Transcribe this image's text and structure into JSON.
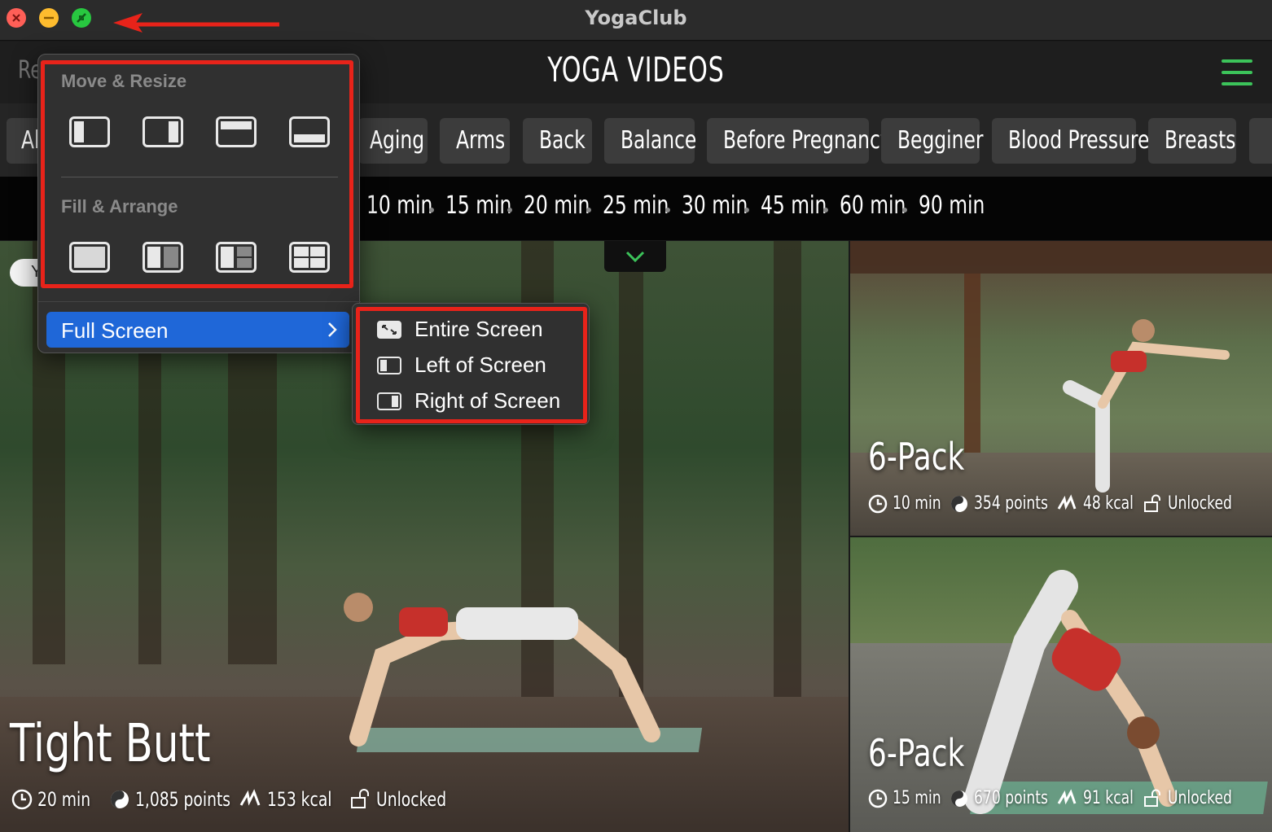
{
  "window": {
    "title": "YogaClub"
  },
  "header": {
    "title": "YOGA VIDEOS",
    "left_partial": "Re"
  },
  "categories": [
    "Ab",
    "Aging",
    "Arms",
    "Back",
    "Balance",
    "Before Pregnancy",
    "Begginer",
    "Blood Pressure",
    "Breasts"
  ],
  "durations": [
    "10 min",
    "15 min",
    "20 min",
    "25 min",
    "30 min",
    "45 min",
    "60 min",
    "90 min"
  ],
  "toggle_partial": "Y",
  "zoom_menu": {
    "move_resize_label": "Move & Resize",
    "fill_arrange_label": "Fill & Arrange",
    "full_screen_label": "Full Screen"
  },
  "full_screen_submenu": {
    "entire": "Entire Screen",
    "left": "Left of Screen",
    "right": "Right of Screen"
  },
  "videos": {
    "main": {
      "title": "Tight Butt",
      "duration": "20 min",
      "points": "1,085 points",
      "kcal": "153 kcal",
      "status": "Unlocked"
    },
    "side1": {
      "title": "6-Pack",
      "duration": "10 min",
      "points": "354 points",
      "kcal": "48 kcal",
      "status": "Unlocked"
    },
    "side2": {
      "title": "6-Pack",
      "duration": "15 min",
      "points": "670 points",
      "kcal": "91 kcal",
      "status": "Unlocked"
    }
  },
  "colors": {
    "accent_green": "#3cc35a",
    "highlight_red": "#e8231a",
    "menu_selected": "#1f67d8"
  },
  "icons": [
    "close-icon",
    "minimize-icon",
    "zoom-icon",
    "hamburger-icon",
    "chevron-down-icon",
    "chevron-right-icon",
    "clock-icon",
    "yin-yang-icon",
    "flame-icon",
    "unlock-icon"
  ]
}
